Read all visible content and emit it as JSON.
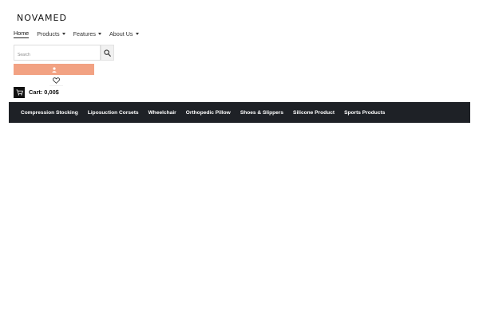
{
  "brand": {
    "logo_text": "NOVAMED"
  },
  "nav": {
    "items": [
      {
        "label": "Home",
        "active": true,
        "has_dropdown": false
      },
      {
        "label": "Products",
        "active": false,
        "has_dropdown": true
      },
      {
        "label": "Features",
        "active": false,
        "has_dropdown": true
      },
      {
        "label": "About Us",
        "active": false,
        "has_dropdown": true
      }
    ]
  },
  "search": {
    "placeholder": "Search",
    "value": ""
  },
  "account": {
    "icon": "user-icon",
    "color": "#f2a283"
  },
  "wishlist": {
    "icon": "heart-icon"
  },
  "cart": {
    "label": "Cart: 0,00$",
    "icon": "cart-icon"
  },
  "categories": {
    "background": "#1e2126",
    "items": [
      "Compression Stocking",
      "Liposuction Corsets",
      "Wheelchair",
      "Orthopedic Pillow",
      "Shoes & Slippers",
      "Silicone Product",
      "Sports Products"
    ]
  }
}
